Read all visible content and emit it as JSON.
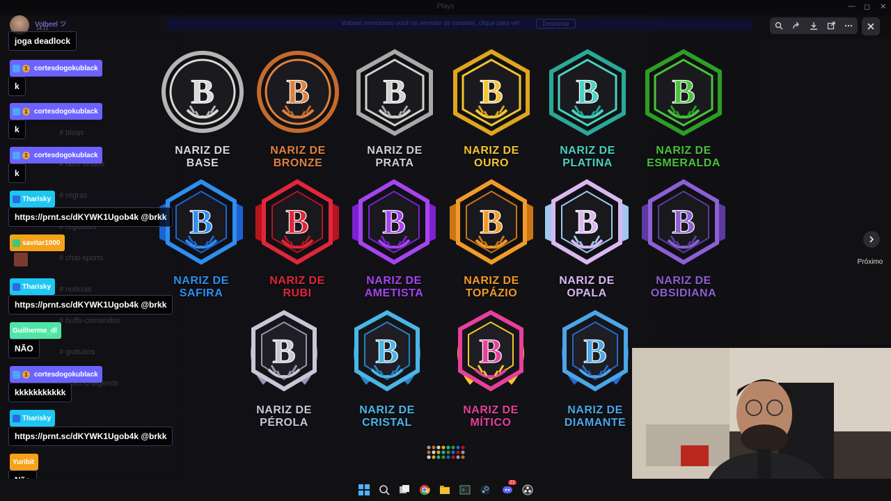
{
  "window": {
    "title": "Plays"
  },
  "notice": {
    "text": "Volbeel mencionou você no servidor de convites, clique para ver",
    "button": "Descartar"
  },
  "background_channels": [
    "bloqs",
    "bom vindos",
    "regras",
    "regulasis",
    "chat-sports",
    "noticias",
    "buffs-comandos",
    "gratuitos",
    "apex-d-legends"
  ],
  "viewer": {
    "tooltip": "Próximo",
    "toolbar_icons": [
      "zoom-icon",
      "forward-icon",
      "download-icon",
      "open-external-icon",
      "more-icon"
    ]
  },
  "badges": [
    {
      "name": "NARIZ DE\nBASE",
      "color": "#d8d8d8",
      "accent": "#b5b5b5",
      "shape": "circle"
    },
    {
      "name": "NARIZ DE\nBRONZE",
      "color": "#e0803c",
      "accent": "#c46a2c",
      "shape": "circle"
    },
    {
      "name": "NARIZ DE\nPRATA",
      "color": "#d0d0d0",
      "accent": "#a9a9a9",
      "shape": "hex"
    },
    {
      "name": "NARIZ DE\nOURO",
      "color": "#f3c531",
      "accent": "#e0a41e",
      "shape": "hex"
    },
    {
      "name": "NARIZ DE\nPLATINA",
      "color": "#48d2c2",
      "accent": "#2aa99a",
      "shape": "hex"
    },
    {
      "name": "NARIZ DE\nESMERALDA",
      "color": "#49c23a",
      "accent": "#2c9e25",
      "shape": "hex"
    },
    {
      "name": "NARIZ DE\nSAFIRA",
      "color": "#2e8ef0",
      "accent": "#1b63d4",
      "shape": "hexwing"
    },
    {
      "name": "NARIZ DE\nRUBI",
      "color": "#e2263a",
      "accent": "#b5141f",
      "shape": "hexwing"
    },
    {
      "name": "NARIZ DE\nAMETISTA",
      "color": "#a743f2",
      "accent": "#7b22d0",
      "shape": "hexwing"
    },
    {
      "name": "NARIZ DE\nTOPÁZIO",
      "color": "#f29a28",
      "accent": "#cc7414",
      "shape": "hexwing"
    },
    {
      "name": "NARIZ DE\nOPALA",
      "color": "#d9b8f2",
      "accent": "#9fc8f0",
      "shape": "hexwing"
    },
    {
      "name": "NARIZ DE\nOBSIDIANA",
      "color": "#8d5fd4",
      "accent": "#5b3b9e",
      "shape": "hexwing"
    },
    {
      "name": "NARIZ DE\nPÉROLA",
      "color": "#c9c6d6",
      "accent": "#9793b3",
      "shape": "wreath"
    },
    {
      "name": "NARIZ DE\nCRISTAL",
      "color": "#49b6e6",
      "accent": "#2682c4",
      "shape": "wreath"
    },
    {
      "name": "NARIZ DE\nMÍTICO",
      "color": "#e8409a",
      "accent": "#f2c82a",
      "shape": "wreath"
    },
    {
      "name": "NARIZ DE\nDIAMANTE",
      "color": "#4ba6e8",
      "accent": "#2469c9",
      "shape": "wreath"
    }
  ],
  "chat": {
    "first": {
      "name": "Volbeel ツ",
      "time": "14:12",
      "text": "joga deadlock"
    },
    "messages": [
      {
        "user": "cortesdogokublack",
        "coin": "1",
        "color": "#6c63ff",
        "badge": "#4aa8ff",
        "text": "k"
      },
      {
        "user": "cortesdogokublack",
        "coin": "1",
        "color": "#6c63ff",
        "badge": "#4aa8ff",
        "text": "k"
      },
      {
        "user": "cortesdogokublack",
        "coin": "1",
        "color": "#6c63ff",
        "badge": "#4aa8ff",
        "text": "k"
      },
      {
        "user": "Tharisky",
        "coin": "",
        "color": "#1ec6f2",
        "badge": "#2b6be0",
        "text": "https://prnt.sc/dKYWK1Ugob4k @brkk"
      },
      {
        "user": "savitar1000",
        "coin": "",
        "color": "#f5a21b",
        "badge": "#3ec77a",
        "text": ""
      },
      {
        "user": "Tharisky",
        "coin": "",
        "color": "#1ec6f2",
        "badge": "#2b6be0",
        "text": "https://prnt.sc/dKYWK1Ugob4k @brkk"
      },
      {
        "user": "Guilherme_dl",
        "coin": "",
        "color": "#4ee6a6",
        "badge": "",
        "text": "NÃO"
      },
      {
        "user": "cortesdogokublack",
        "coin": "1",
        "color": "#6c63ff",
        "badge": "#4aa8ff",
        "text": "kkkkkkkkkkk"
      },
      {
        "user": "Tharisky",
        "coin": "",
        "color": "#1ec6f2",
        "badge": "#2b6be0",
        "text": "https://prnt.sc/dKYWK1Ugob4k @brkk"
      },
      {
        "user": "Yuribit",
        "coin": "",
        "color": "#f5a21b",
        "badge": "",
        "text": "Não"
      }
    ]
  },
  "taskbar": {
    "apps": [
      "windows-start-icon",
      "search-icon",
      "task-view-icon",
      "chrome-icon",
      "file-explorer-icon",
      "terminal-icon",
      "steam-icon",
      "discord-icon",
      "obs-icon"
    ],
    "discord_badge": "21"
  }
}
